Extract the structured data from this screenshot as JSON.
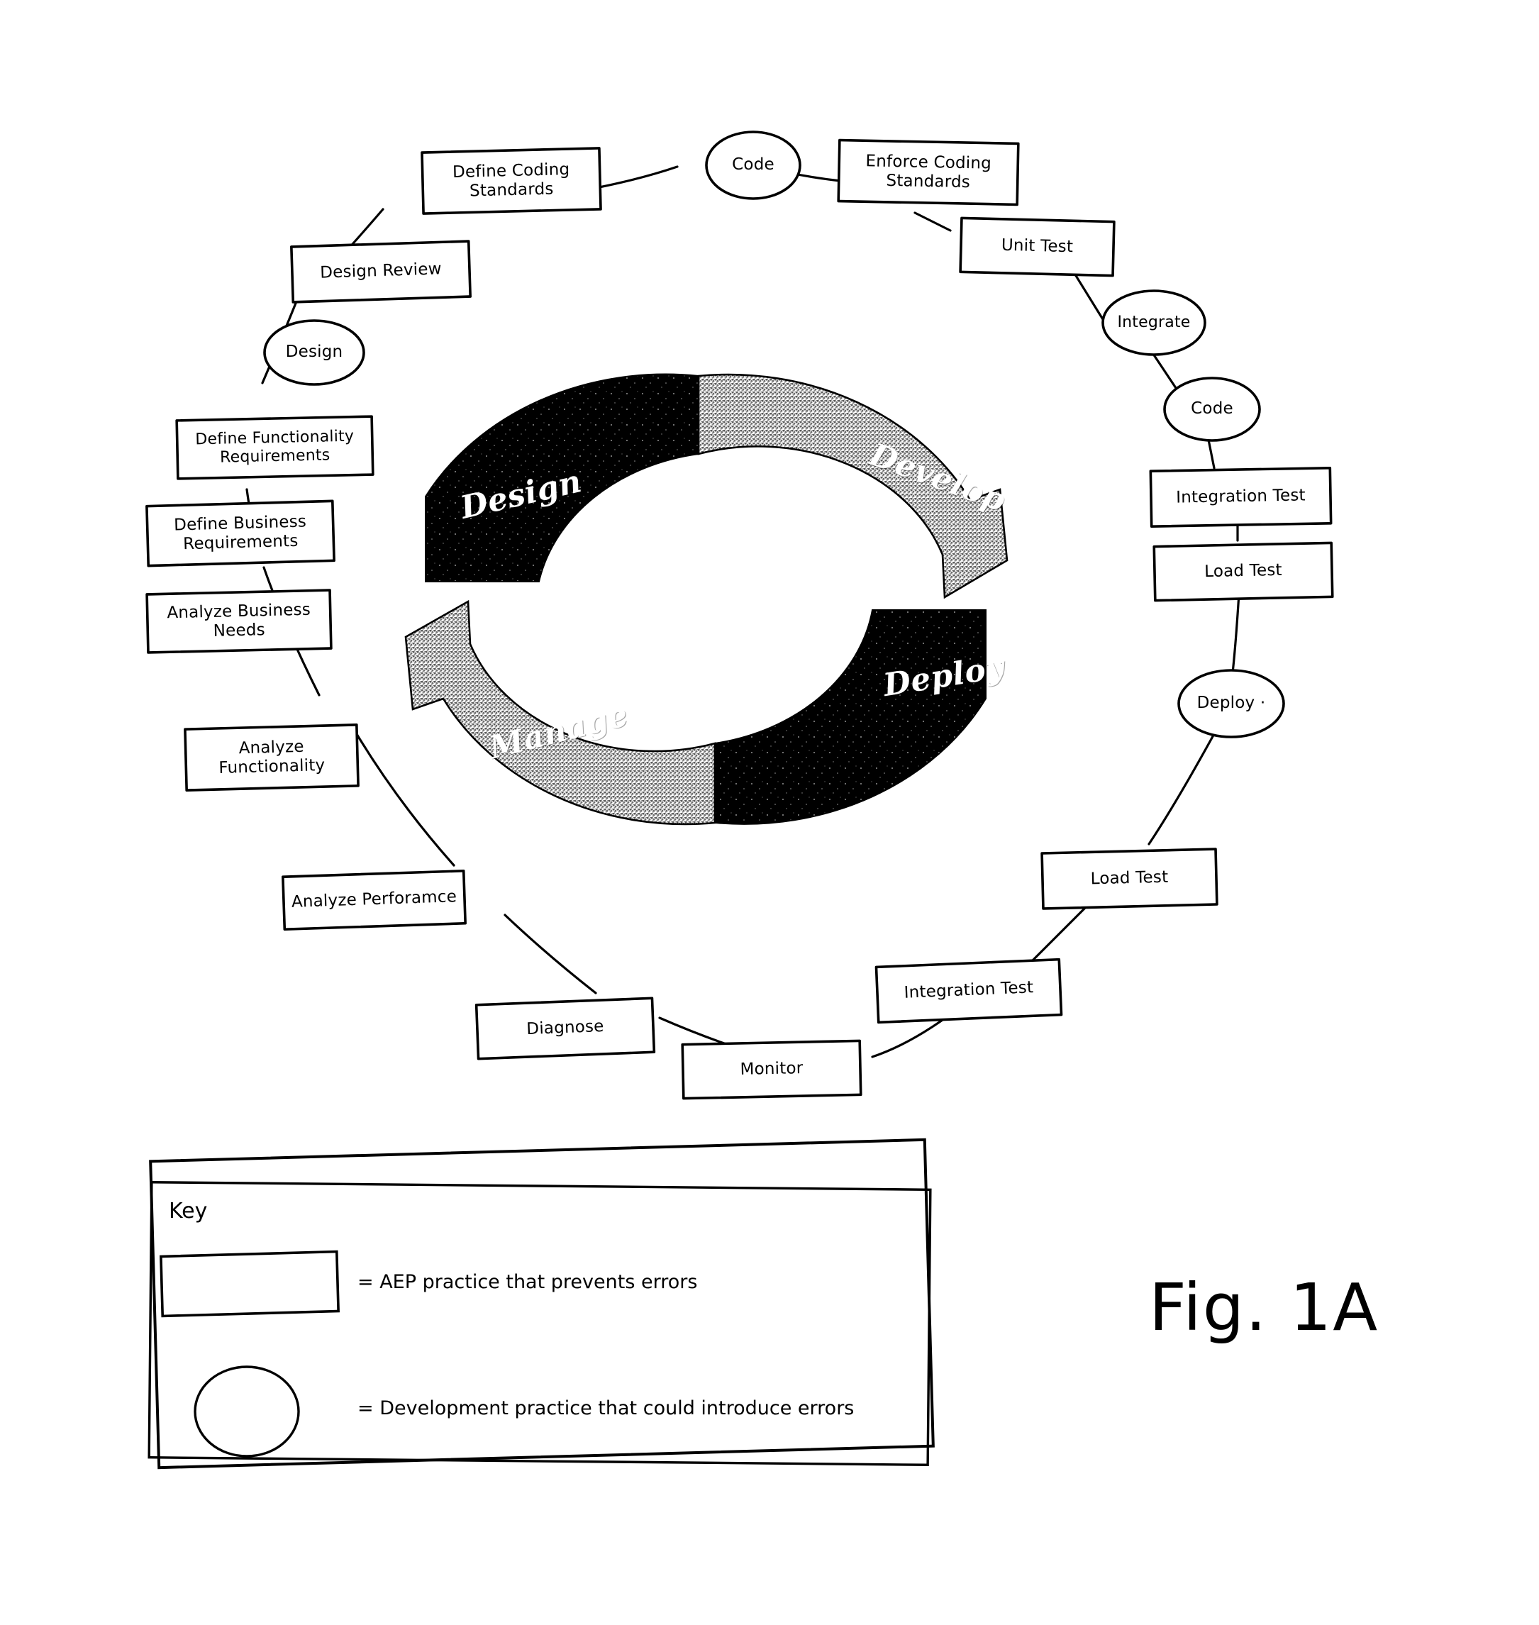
{
  "figure": {
    "caption": "Fig. 1A",
    "background_color": "#ffffff",
    "ink_color": "#000000"
  },
  "cycle": {
    "segments": [
      {
        "label": "Design",
        "fill": "dark",
        "position": "top-left"
      },
      {
        "label": "Develop",
        "fill": "light",
        "position": "top-right"
      },
      {
        "label": "Deploy",
        "fill": "dark",
        "position": "bottom-right"
      },
      {
        "label": "Manage",
        "fill": "light",
        "position": "bottom-left"
      }
    ],
    "dark_color": "#000000",
    "light_color": "#b5b5b5",
    "text_color": "#ffffff"
  },
  "nodes": [
    {
      "id": "code-top",
      "shape": "ellipse",
      "label": "Code"
    },
    {
      "id": "define-coding",
      "shape": "rectangle",
      "label": "Define Coding\nStandards"
    },
    {
      "id": "enforce-coding",
      "shape": "rectangle",
      "label": "Enforce Coding\nStandards"
    },
    {
      "id": "design-review",
      "shape": "rectangle",
      "label": "Design Review"
    },
    {
      "id": "unit-test",
      "shape": "rectangle",
      "label": "Unit Test"
    },
    {
      "id": "design",
      "shape": "ellipse",
      "label": "Design"
    },
    {
      "id": "integrate",
      "shape": "ellipse",
      "label": "Integrate"
    },
    {
      "id": "define-functionality",
      "shape": "rectangle",
      "label": "Define Functionality\nRequirements"
    },
    {
      "id": "code-right",
      "shape": "ellipse",
      "label": "Code"
    },
    {
      "id": "define-business",
      "shape": "rectangle",
      "label": "Define Business\nRequirements"
    },
    {
      "id": "integration-test-r",
      "shape": "rectangle",
      "label": "Integration Test"
    },
    {
      "id": "analyze-business",
      "shape": "rectangle",
      "label": "Analyze Business\nNeeds"
    },
    {
      "id": "load-test-r",
      "shape": "rectangle",
      "label": "Load Test"
    },
    {
      "id": "analyze-functionality",
      "shape": "rectangle",
      "label": "Analyze\nFunctionality"
    },
    {
      "id": "deploy",
      "shape": "ellipse",
      "label": "Deploy  ·"
    },
    {
      "id": "analyze-performance",
      "shape": "rectangle",
      "label": "Analyze Perforamce"
    },
    {
      "id": "load-test-b",
      "shape": "rectangle",
      "label": "Load Test"
    },
    {
      "id": "diagnose",
      "shape": "rectangle",
      "label": "Diagnose"
    },
    {
      "id": "integration-test-b",
      "shape": "rectangle",
      "label": "Integration Test"
    },
    {
      "id": "monitor",
      "shape": "rectangle",
      "label": "Monitor"
    }
  ],
  "key": {
    "title": "Key",
    "entries": [
      {
        "swatch": "rectangle",
        "text": "= AEP practice that prevents errors"
      },
      {
        "swatch": "ellipse",
        "text": "= Development practice that could introduce errors"
      }
    ]
  }
}
